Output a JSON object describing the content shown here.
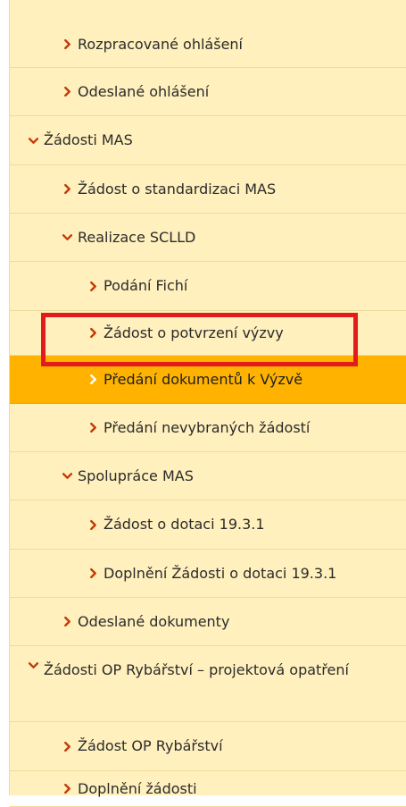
{
  "menu": {
    "items": [
      {
        "label": "Rozpracované ohlášení",
        "state": "collapsed"
      },
      {
        "label": "Odeslané ohlášení",
        "state": "collapsed"
      },
      {
        "label": "Žádosti MAS",
        "state": "expanded"
      },
      {
        "label": "Žádost o standardizaci MAS",
        "state": "collapsed"
      },
      {
        "label": "Realizace SCLLD",
        "state": "expanded"
      },
      {
        "label": "Podání Fichí",
        "state": "collapsed"
      },
      {
        "label": "Žádost o potvrzení výzvy",
        "state": "collapsed"
      },
      {
        "label": "Předání dokumentů k Výzvě",
        "state": "collapsed",
        "active": true
      },
      {
        "label": "Předání nevybraných žádostí",
        "state": "collapsed"
      },
      {
        "label": "Spolupráce MAS",
        "state": "expanded"
      },
      {
        "label": "Žádost o dotaci 19.3.1",
        "state": "collapsed"
      },
      {
        "label": "Doplnění Žádosti o dotaci 19.3.1",
        "state": "collapsed"
      },
      {
        "label": "Odeslané dokumenty",
        "state": "collapsed"
      },
      {
        "label": "Žádosti OP Rybářství – projektová opatření",
        "state": "expanded"
      },
      {
        "label": "Žádost OP Rybářství",
        "state": "collapsed"
      },
      {
        "label": "Doplnění žádosti",
        "state": "collapsed"
      }
    ]
  },
  "colors": {
    "menu_bg": "#fff0bd",
    "active_bg": "#ffb300",
    "highlight_border": "#e41b1b"
  }
}
